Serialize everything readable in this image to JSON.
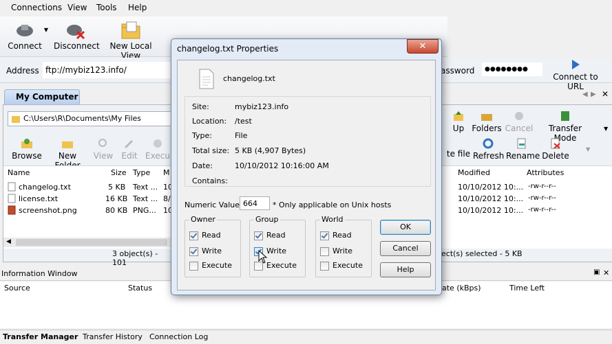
{
  "menu": {
    "items": [
      {
        "label": "Connections"
      },
      {
        "label": "View"
      },
      {
        "label": "Tools"
      },
      {
        "label": "Help"
      }
    ]
  },
  "toolbar": {
    "connect": "Connect",
    "disconnect": "Disconnect",
    "new_local_view": "New Local View"
  },
  "address": {
    "label": "Address",
    "value": "ftp://mybiz123.info/",
    "password_label": "assword",
    "password_value": "●●●●●●●●",
    "connect_to_url": "Connect to URL"
  },
  "local_pane": {
    "tab_label": "My Computer",
    "path": "C:\\Users\\R\\Documents\\My Files",
    "actions": [
      "Browse",
      "New Folder",
      "View",
      "Edit",
      "Execu"
    ],
    "columns": [
      "Name",
      "Size",
      "Type",
      "M"
    ],
    "files": [
      {
        "name": "changelog.txt",
        "size": "5 KB",
        "type": "Text ...",
        "mod": "10"
      },
      {
        "name": "license.txt",
        "size": "16 KB",
        "type": "Text ...",
        "mod": "8/"
      },
      {
        "name": "screenshot.png",
        "size": "80 KB",
        "type": "PNG...",
        "mod": "10"
      }
    ],
    "status": "3 object(s) - 101"
  },
  "remote_pane": {
    "actions": [
      "Up",
      "Folders",
      "Cancel",
      "Transfer Mode"
    ],
    "actions2": [
      "te file",
      "Refresh",
      "Rename",
      "Delete"
    ],
    "columns": [
      "Modified",
      "Attributes"
    ],
    "files": [
      {
        "modified": "10/10/2012 10:...",
        "attributes": "-rw-r--r--"
      },
      {
        "modified": "10/10/2012 10:...",
        "attributes": "-rw-r--r--"
      },
      {
        "modified": "10/10/2012 10:...",
        "attributes": "-rw-r--r--"
      }
    ],
    "status": "ect(s) selected - 5 KB"
  },
  "info_window": {
    "title": "Information Window",
    "columns": [
      "Source",
      "Status",
      "ate (kBps)",
      "Time Left"
    ]
  },
  "bottom_tabs": [
    "Transfer Manager",
    "Transfer History",
    "Connection Log"
  ],
  "dialog": {
    "title": "changelog.txt Properties",
    "close": "✕",
    "filename": "changelog.txt",
    "fields": [
      {
        "label": "Site:",
        "value": "mybiz123.info"
      },
      {
        "label": "Location:",
        "value": "/test"
      },
      {
        "label": "Type:",
        "value": "File"
      },
      {
        "label": "Total size:",
        "value": "5 KB (4,907 Bytes)"
      },
      {
        "label": "Date:",
        "value": "10/10/2012 10:16:00 AM"
      },
      {
        "label": "Contains:",
        "value": ""
      }
    ],
    "numeric_label": "Numeric Value:",
    "numeric_value": "664",
    "numeric_note": "* Only applicable on Unix hosts",
    "groups": [
      {
        "title": "Owner",
        "read": true,
        "write": true,
        "execute": false
      },
      {
        "title": "Group",
        "read": true,
        "write": true,
        "execute": false
      },
      {
        "title": "World",
        "read": true,
        "write": false,
        "execute": false
      }
    ],
    "perm_labels": {
      "read": "Read",
      "write": "Write",
      "execute": "Execute"
    },
    "buttons": {
      "ok": "OK",
      "cancel": "Cancel",
      "help": "Help"
    }
  }
}
